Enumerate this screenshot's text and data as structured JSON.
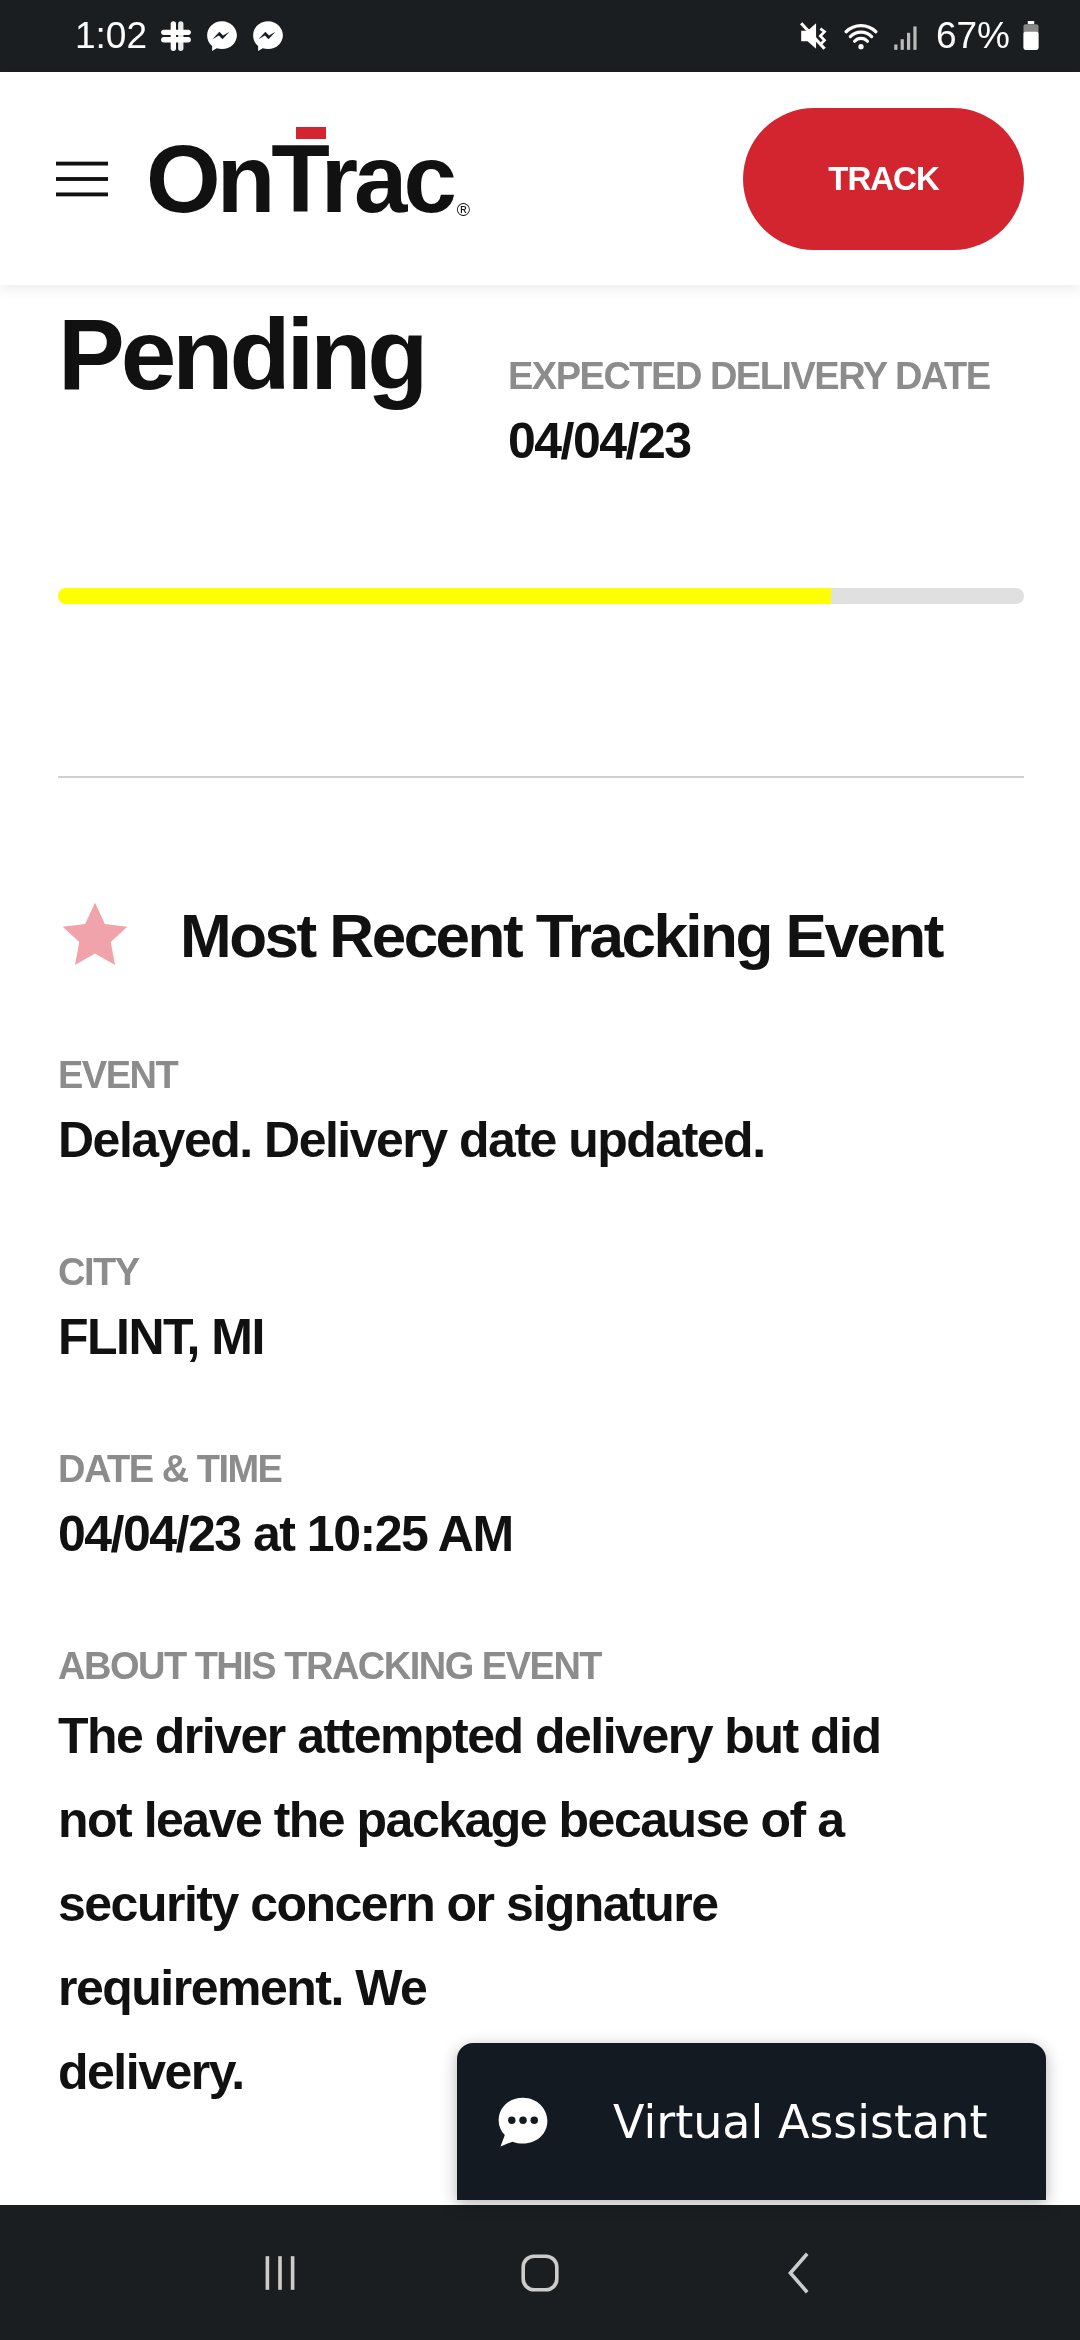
{
  "status_bar": {
    "time": "1:02",
    "battery": "67%"
  },
  "header": {
    "logo": "OnTrac",
    "logo_mark": "®",
    "track_button": "TRACK"
  },
  "shipment": {
    "status": "Pending",
    "expected_label": "EXPECTED DELIVERY DATE",
    "expected_date": "04/04/23",
    "progress": {
      "level": 0.8
    }
  },
  "recent_event": {
    "title": "Most Recent Tracking Event",
    "fields": [
      {
        "label": "EVENT",
        "value": "Delayed. Delivery date updated."
      },
      {
        "label": "CITY",
        "value": "FLINT, MI"
      },
      {
        "label": "DATE & TIME",
        "value": "04/04/23 at 10:25 AM"
      }
    ],
    "about": {
      "label": "ABOUT THIS TRACKING EVENT",
      "lines": [
        "The driver attempted delivery but did",
        "not leave the package because of a",
        "security concern or signature",
        "requirement. We",
        "delivery."
      ]
    }
  },
  "assistant_button": {
    "label": "Virtual Assistant"
  }
}
